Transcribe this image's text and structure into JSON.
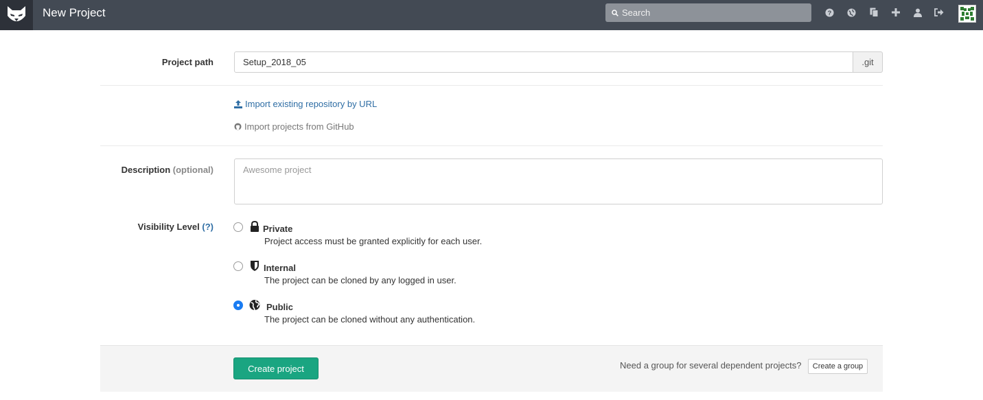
{
  "header": {
    "title": "New Project",
    "search_placeholder": "Search",
    "icons": [
      "help-icon",
      "globe-icon",
      "copy-icon",
      "plus-icon",
      "user-icon",
      "sign-out-icon"
    ]
  },
  "form": {
    "path_label": "Project path",
    "path_value": "Setup_2018_05",
    "path_suffix": ".git",
    "import_url_label": "Import existing repository by URL",
    "import_github_label": "Import projects from GitHub",
    "description_label": "Description",
    "description_optional": "(optional)",
    "description_placeholder": "Awesome project",
    "visibility_label": "Visibility Level",
    "visibility_help": "(?)",
    "visibility_options": [
      {
        "title": "Private",
        "description": "Project access must be granted explicitly for each user.",
        "icon": "lock-icon",
        "checked": false
      },
      {
        "title": "Internal",
        "description": "The project can be cloned by any logged in user.",
        "icon": "shield-icon",
        "checked": false
      },
      {
        "title": "Public",
        "description": "The project can be cloned without any authentication.",
        "icon": "globe-icon",
        "checked": true
      }
    ]
  },
  "footer": {
    "create_label": "Create project",
    "group_prompt": "Need a group for several dependent projects?",
    "create_group_label": "Create a group"
  },
  "colors": {
    "navbar": "#434a54",
    "link": "#2e6da4",
    "create_button": "#1aa581",
    "radio_checked": "#1a7cf2"
  }
}
